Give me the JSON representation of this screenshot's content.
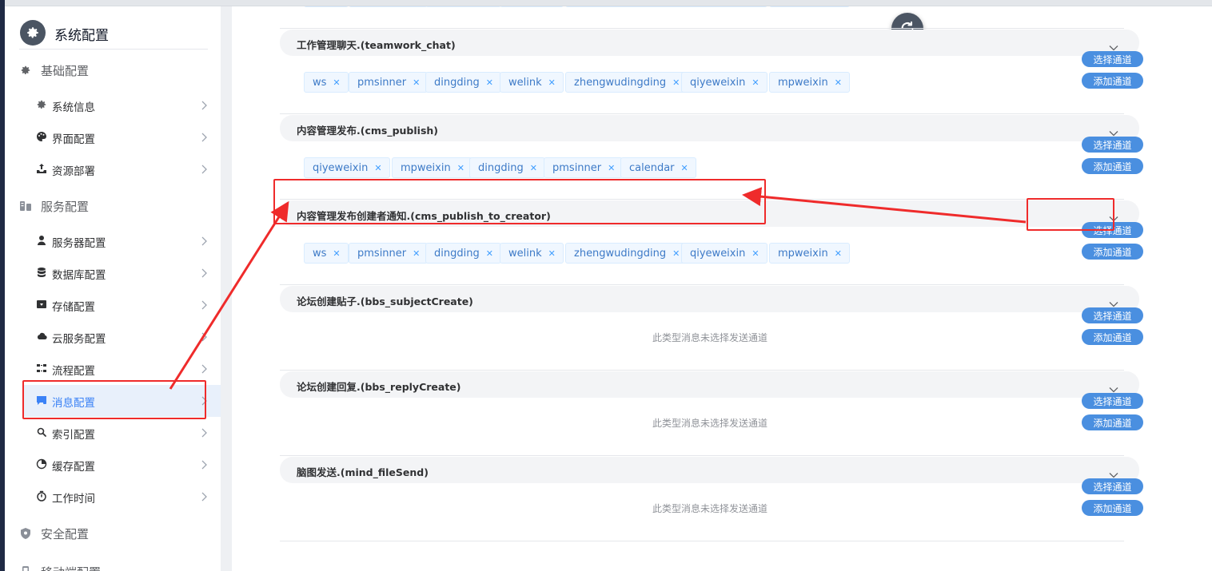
{
  "sidebar": {
    "title": "系统配置",
    "groups": [
      {
        "label": "基础配置",
        "icon": "gear-icon"
      },
      {
        "label": "服务配置",
        "icon": "server-icon"
      },
      {
        "label": "安全配置",
        "icon": "shield-icon"
      },
      {
        "label": "移动端配置",
        "icon": "mobile-icon"
      }
    ],
    "items": [
      {
        "label": "系统信息",
        "icon": "gear-icon"
      },
      {
        "label": "界面配置",
        "icon": "palette-icon"
      },
      {
        "label": "资源部署",
        "icon": "deploy-icon"
      },
      {
        "label": "服务器配置",
        "icon": "server-node-icon"
      },
      {
        "label": "数据库配置",
        "icon": "database-icon"
      },
      {
        "label": "存储配置",
        "icon": "storage-icon"
      },
      {
        "label": "云服务配置",
        "icon": "cloud-icon"
      },
      {
        "label": "流程配置",
        "icon": "flow-icon"
      },
      {
        "label": "消息配置",
        "icon": "message-icon",
        "active": true
      },
      {
        "label": "索引配置",
        "icon": "search-icon"
      },
      {
        "label": "缓存配置",
        "icon": "pie-icon"
      },
      {
        "label": "工作时间",
        "icon": "timer-icon"
      }
    ]
  },
  "buttons": {
    "select_channel": "选择通道",
    "add_channel": "添加通道"
  },
  "empty_text": "此类型消息未选择发送通道",
  "sections": [
    {
      "title": "",
      "tags": [
        "ws",
        "pmsinner",
        "dingding",
        "welink",
        "zhengwudingding",
        "qiyeweixin",
        "mpweixin"
      ]
    },
    {
      "title": "工作管理聊天.(teamwork_chat)",
      "tags": [
        "ws",
        "pmsinner",
        "dingding",
        "welink",
        "zhengwudingding",
        "qiyeweixin",
        "mpweixin"
      ]
    },
    {
      "title": "内容管理发布.(cms_publish)",
      "tags": [
        "qiyeweixin",
        "mpweixin",
        "dingding",
        "pmsinner",
        "calendar"
      ]
    },
    {
      "title": "内容管理发布创建者通知.(cms_publish_to_creator)",
      "tags": [
        "ws",
        "pmsinner",
        "dingding",
        "welink",
        "zhengwudingding",
        "qiyeweixin",
        "mpweixin"
      ]
    },
    {
      "title": "论坛创建贴子.(bbs_subjectCreate)",
      "tags": []
    },
    {
      "title": "论坛创建回复.(bbs_replyCreate)",
      "tags": []
    },
    {
      "title": "脑图发送.(mind_fileSend)",
      "tags": []
    }
  ],
  "colors": {
    "accent": "#4a8fe0",
    "annotation": "#ef2b2b",
    "active_bg": "#e8f0fb",
    "tag_text": "#3d7ac7"
  }
}
